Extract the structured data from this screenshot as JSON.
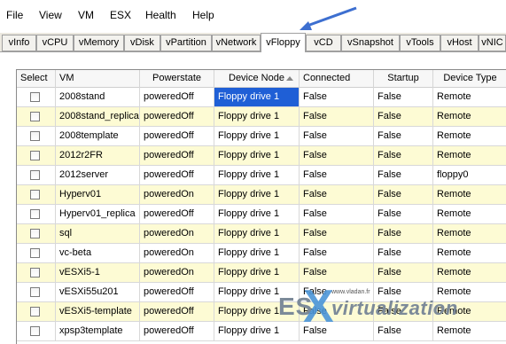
{
  "menu": {
    "items": [
      "File",
      "View",
      "VM",
      "ESX",
      "Health",
      "Help"
    ]
  },
  "tabs": [
    {
      "label": "vInfo"
    },
    {
      "label": "vCPU"
    },
    {
      "label": "vMemory"
    },
    {
      "label": "vDisk"
    },
    {
      "label": "vPartition"
    },
    {
      "label": "vNetwork"
    },
    {
      "label": "vFloppy",
      "active": true
    },
    {
      "label": "vCD"
    },
    {
      "label": "vSnapshot"
    },
    {
      "label": "vTools"
    },
    {
      "label": "vHost"
    },
    {
      "label": "vNIC"
    }
  ],
  "table": {
    "columns": [
      "Select",
      "VM",
      "Powerstate",
      "Device Node",
      "Connected",
      "Startup",
      "Device Type"
    ],
    "rows": [
      {
        "vm": "2008stand",
        "powerstate": "poweredOff",
        "device_node": "Floppy drive 1",
        "connected": "False",
        "startup": "False",
        "device_type": "Remote"
      },
      {
        "vm": "2008stand_replica",
        "powerstate": "poweredOff",
        "device_node": "Floppy drive 1",
        "connected": "False",
        "startup": "False",
        "device_type": "Remote"
      },
      {
        "vm": "2008template",
        "powerstate": "poweredOff",
        "device_node": "Floppy drive 1",
        "connected": "False",
        "startup": "False",
        "device_type": "Remote"
      },
      {
        "vm": "2012r2FR",
        "powerstate": "poweredOff",
        "device_node": "Floppy drive 1",
        "connected": "False",
        "startup": "False",
        "device_type": "Remote"
      },
      {
        "vm": "2012server",
        "powerstate": "poweredOff",
        "device_node": "Floppy drive 1",
        "connected": "False",
        "startup": "False",
        "device_type": "floppy0"
      },
      {
        "vm": "Hyperv01",
        "powerstate": "poweredOn",
        "device_node": "Floppy drive 1",
        "connected": "False",
        "startup": "False",
        "device_type": "Remote"
      },
      {
        "vm": "Hyperv01_replica",
        "powerstate": "poweredOff",
        "device_node": "Floppy drive 1",
        "connected": "False",
        "startup": "False",
        "device_type": "Remote"
      },
      {
        "vm": "sql",
        "powerstate": "poweredOn",
        "device_node": "Floppy drive 1",
        "connected": "False",
        "startup": "False",
        "device_type": "Remote"
      },
      {
        "vm": "vc-beta",
        "powerstate": "poweredOn",
        "device_node": "Floppy drive 1",
        "connected": "False",
        "startup": "False",
        "device_type": "Remote"
      },
      {
        "vm": "vESXi5-1",
        "powerstate": "poweredOn",
        "device_node": "Floppy drive 1",
        "connected": "False",
        "startup": "False",
        "device_type": "Remote"
      },
      {
        "vm": "vESXi55u201",
        "powerstate": "poweredOff",
        "device_node": "Floppy drive 1",
        "connected": "False",
        "startup": "False",
        "device_type": "Remote"
      },
      {
        "vm": "vESXi5-template",
        "powerstate": "poweredOff",
        "device_node": "Floppy drive 1",
        "connected": "False",
        "startup": "False",
        "device_type": "Remote"
      },
      {
        "vm": "xpsp3template",
        "powerstate": "poweredOff",
        "device_node": "Floppy drive 1",
        "connected": "False",
        "startup": "False",
        "device_type": "Remote"
      }
    ]
  },
  "watermark": {
    "url": "www.vladan.fr",
    "es": "ES",
    "x": "X",
    "rest": "virtualization"
  },
  "colors": {
    "row_highlight": "#fdfbd4",
    "selection": "#1f5fd6",
    "arrow": "#3d6fd0"
  }
}
